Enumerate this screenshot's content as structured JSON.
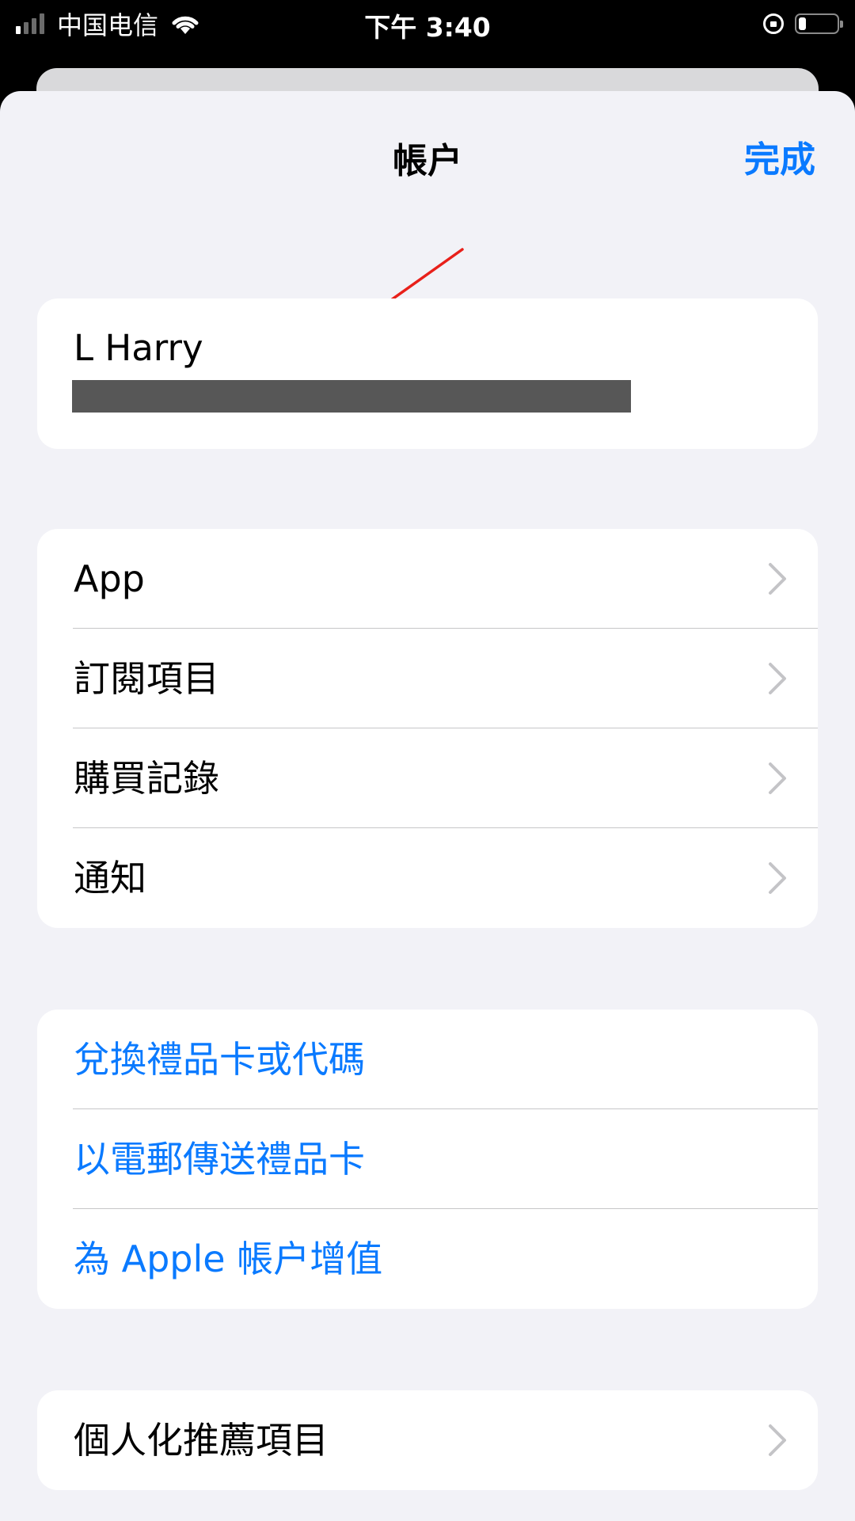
{
  "status_bar": {
    "carrier": "中国电信",
    "time": "下午 3:40",
    "signal_bars_active": 1,
    "battery_level": 0.2
  },
  "nav": {
    "title": "帳户",
    "done_label": "完成"
  },
  "profile": {
    "name": "L Harry"
  },
  "menu_1": {
    "items": [
      {
        "label": "App"
      },
      {
        "label": "訂閱項目"
      },
      {
        "label": "購買記錄"
      },
      {
        "label": "通知"
      }
    ]
  },
  "menu_2": {
    "items": [
      {
        "label": "兌換禮品卡或代碼"
      },
      {
        "label": "以電郵傳送禮品卡"
      },
      {
        "label": "為 Apple 帳户增值"
      }
    ]
  },
  "menu_3": {
    "items": [
      {
        "label": "個人化推薦項目"
      }
    ]
  },
  "colors": {
    "accent": "#0a7aff",
    "background": "#f2f2f7",
    "card": "#ffffff",
    "annotation_arrow": "#e8201a"
  },
  "icons": {
    "row_disclosure": "chevron-right-icon",
    "annotation": "red-arrow-icon"
  }
}
